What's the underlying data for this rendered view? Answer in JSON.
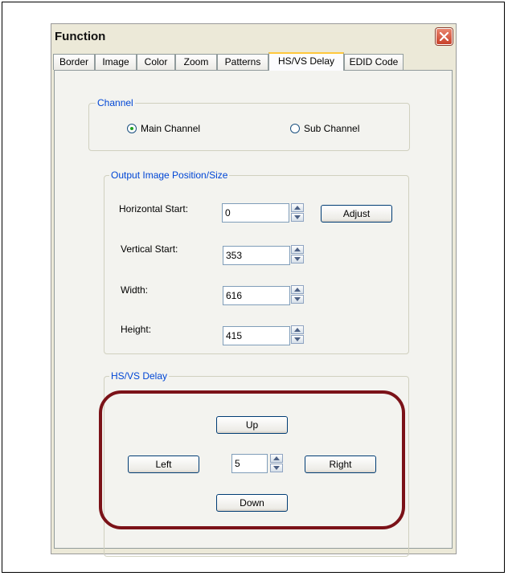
{
  "window": {
    "title": "Function",
    "close_icon": "close-icon"
  },
  "tabs": [
    "Border",
    "Image",
    "Color",
    "Zoom",
    "Patterns",
    "HS/VS Delay",
    "EDID Code"
  ],
  "active_tab": "HS/VS Delay",
  "channel": {
    "legend": "Channel",
    "options": [
      "Main Channel",
      "Sub Channel"
    ],
    "selected": "Main Channel"
  },
  "output": {
    "legend": "Output Image Position/Size",
    "horizontal_start": {
      "label": "Horizontal Start:",
      "value": "0"
    },
    "vertical_start": {
      "label": "Vertical Start:",
      "value": "353"
    },
    "width": {
      "label": "Width:",
      "value": "616"
    },
    "height": {
      "label": "Height:",
      "value": "415"
    },
    "adjust_label": "Adjust"
  },
  "delay": {
    "legend": "HS/VS Delay",
    "up_label": "Up",
    "down_label": "Down",
    "left_label": "Left",
    "right_label": "Right",
    "step_value": "5"
  },
  "colors": {
    "legend": "#0046d5",
    "highlight": "#7b1218",
    "close": "#c8402a"
  }
}
